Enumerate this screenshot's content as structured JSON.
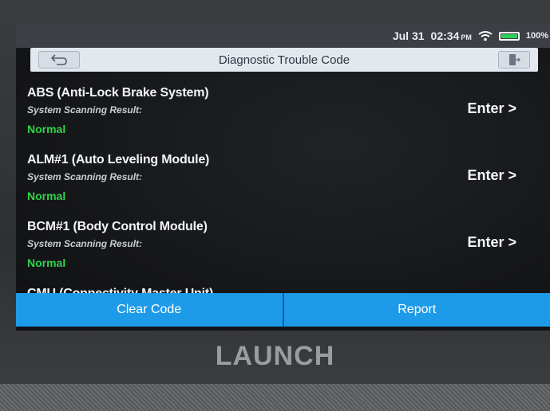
{
  "status_bar": {
    "date": "Jul 31",
    "time": "02:34",
    "ampm": "PM",
    "battery": "100%"
  },
  "header": {
    "title": "Diagnostic Trouble Code",
    "back_icon": "back-arrow-icon",
    "exit_icon": "exit-door-icon"
  },
  "modules": [
    {
      "name": "ABS (Anti-Lock Brake System)",
      "subtitle": "System Scanning Result:",
      "status": "Normal",
      "action": "Enter >"
    },
    {
      "name": "ALM#1 (Auto Leveling Module)",
      "subtitle": "System Scanning Result:",
      "status": "Normal",
      "action": "Enter >"
    },
    {
      "name": "BCM#1 (Body Control Module)",
      "subtitle": "System Scanning Result:",
      "status": "Normal",
      "action": "Enter >"
    },
    {
      "name": "CMU (Connectivity Master Unit)"
    }
  ],
  "actions": {
    "clear_code": "Clear Code",
    "report": "Report"
  },
  "brand": "LAUNCH",
  "colors": {
    "status_normal": "#31d34a",
    "action_bar": "#1e9be8",
    "battery_fill": "#30d158"
  }
}
